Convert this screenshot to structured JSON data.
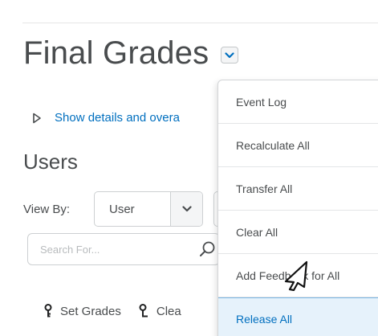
{
  "header": {
    "title": "Final Grades"
  },
  "details_link": {
    "label": "Show details and overa"
  },
  "section": {
    "title": "Users"
  },
  "view_by": {
    "label": "View By:",
    "value": "User"
  },
  "search": {
    "placeholder": "Search For..."
  },
  "actions": [
    {
      "label": "Set Grades",
      "icon": "key-icon"
    },
    {
      "label": "Clea",
      "icon": "key-icon"
    }
  ],
  "menu": {
    "items": [
      {
        "label": "Event Log"
      },
      {
        "label": "Recalculate All"
      },
      {
        "label": "Transfer All"
      },
      {
        "label": "Clear All"
      },
      {
        "label": "Add Feedback for All"
      },
      {
        "label": "Release All"
      }
    ],
    "active_index": 5
  },
  "colors": {
    "link": "#006fbf",
    "text": "#494c4e",
    "highlight": "#e6f2fb"
  }
}
